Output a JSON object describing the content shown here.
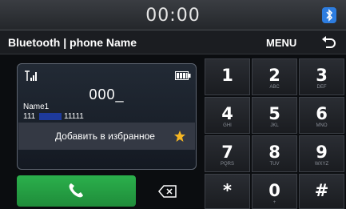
{
  "status": {
    "time": "00:00"
  },
  "header": {
    "title": "Bluetooth | phone Name",
    "menu_label": "MENU"
  },
  "dial": {
    "number": "000_",
    "contact_name": "Name1",
    "contact_phone_part1": "111",
    "contact_phone_part2": "11111",
    "favorite_label": "Добавить в избранное"
  },
  "keypad": [
    {
      "digit": "1",
      "letters": ""
    },
    {
      "digit": "2",
      "letters": "ABC"
    },
    {
      "digit": "3",
      "letters": "DEF"
    },
    {
      "digit": "4",
      "letters": "GHI"
    },
    {
      "digit": "5",
      "letters": "JKL"
    },
    {
      "digit": "6",
      "letters": "MNO"
    },
    {
      "digit": "7",
      "letters": "PQRS"
    },
    {
      "digit": "8",
      "letters": "TUV"
    },
    {
      "digit": "9",
      "letters": "WXYZ"
    },
    {
      "digit": "*",
      "letters": ""
    },
    {
      "digit": "0",
      "letters": "+"
    },
    {
      "digit": "#",
      "letters": ""
    }
  ],
  "colors": {
    "call_green": "#22a044",
    "star": "#f5b623",
    "bluetooth_badge": "#2d7de0",
    "redaction": "#1e3a9c"
  },
  "icons": {
    "signal": "signal-icon",
    "battery": "battery-icon",
    "bluetooth": "bluetooth-icon",
    "back": "back-icon",
    "call": "phone-icon",
    "backspace": "backspace-icon",
    "favorite": "star-icon"
  }
}
